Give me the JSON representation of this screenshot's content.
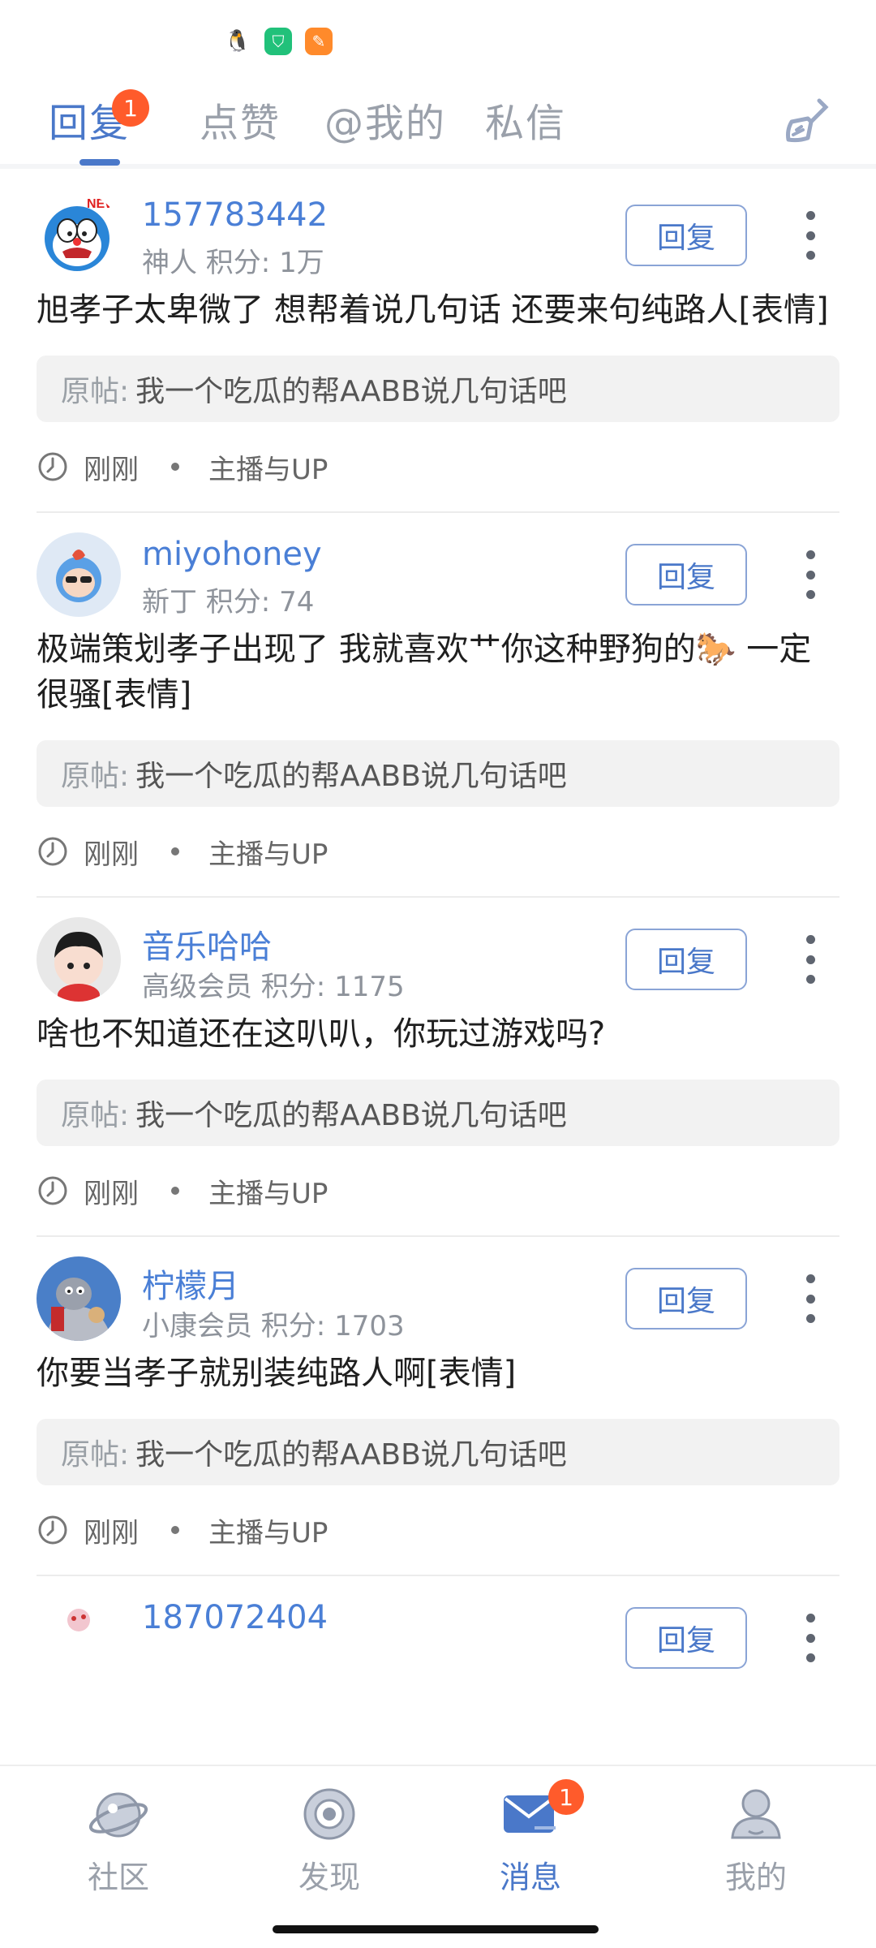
{
  "tabs": [
    {
      "label": "回复",
      "badge": "1",
      "active": true
    },
    {
      "label": "点赞"
    },
    {
      "label": "@我的"
    },
    {
      "label": "私信"
    }
  ],
  "items": [
    {
      "name": "157783442",
      "meta": "神人 积分: 1万",
      "content": "旭孝子太卑微了 想帮着说几句话 还要来句纯路人[表情]",
      "orig_key": "原帖:",
      "orig_title": "我一个吃瓜的帮AABB说几句话吧",
      "time": "刚刚",
      "section": "主播与UP",
      "reply_label": "回复"
    },
    {
      "name": "miyohoney",
      "meta": "新丁 积分: 74",
      "content": "极端策划孝子出现了 我就喜欢艹你这种野狗的🐎 一定很骚[表情]",
      "orig_key": "原帖:",
      "orig_title": "我一个吃瓜的帮AABB说几句话吧",
      "time": "刚刚",
      "section": "主播与UP",
      "reply_label": "回复"
    },
    {
      "name": "音乐哈哈",
      "meta": "高级会员 积分: 1175",
      "content": "啥也不知道还在这叭叭，你玩过游戏吗?",
      "orig_key": "原帖:",
      "orig_title": "我一个吃瓜的帮AABB说几句话吧",
      "time": "刚刚",
      "section": "主播与UP",
      "reply_label": "回复"
    },
    {
      "name": "柠檬月",
      "meta": "小康会员 积分: 1703",
      "content": "你要当孝子就别装纯路人啊[表情]",
      "orig_key": "原帖:",
      "orig_title": "我一个吃瓜的帮AABB说几句话吧",
      "time": "刚刚",
      "section": "主播与UP",
      "reply_label": "回复"
    },
    {
      "name": "187072404",
      "reply_label": "回复"
    }
  ],
  "bottom_nav": [
    {
      "label": "社区",
      "icon": "planet-icon"
    },
    {
      "label": "发现",
      "icon": "discover-icon"
    },
    {
      "label": "消息",
      "icon": "mail-icon",
      "badge": "1",
      "active": true
    },
    {
      "label": "我的",
      "icon": "user-icon"
    }
  ],
  "colors": {
    "accent": "#4a78c9",
    "badge": "#ff5b2b",
    "name": "#4a7fd6"
  }
}
